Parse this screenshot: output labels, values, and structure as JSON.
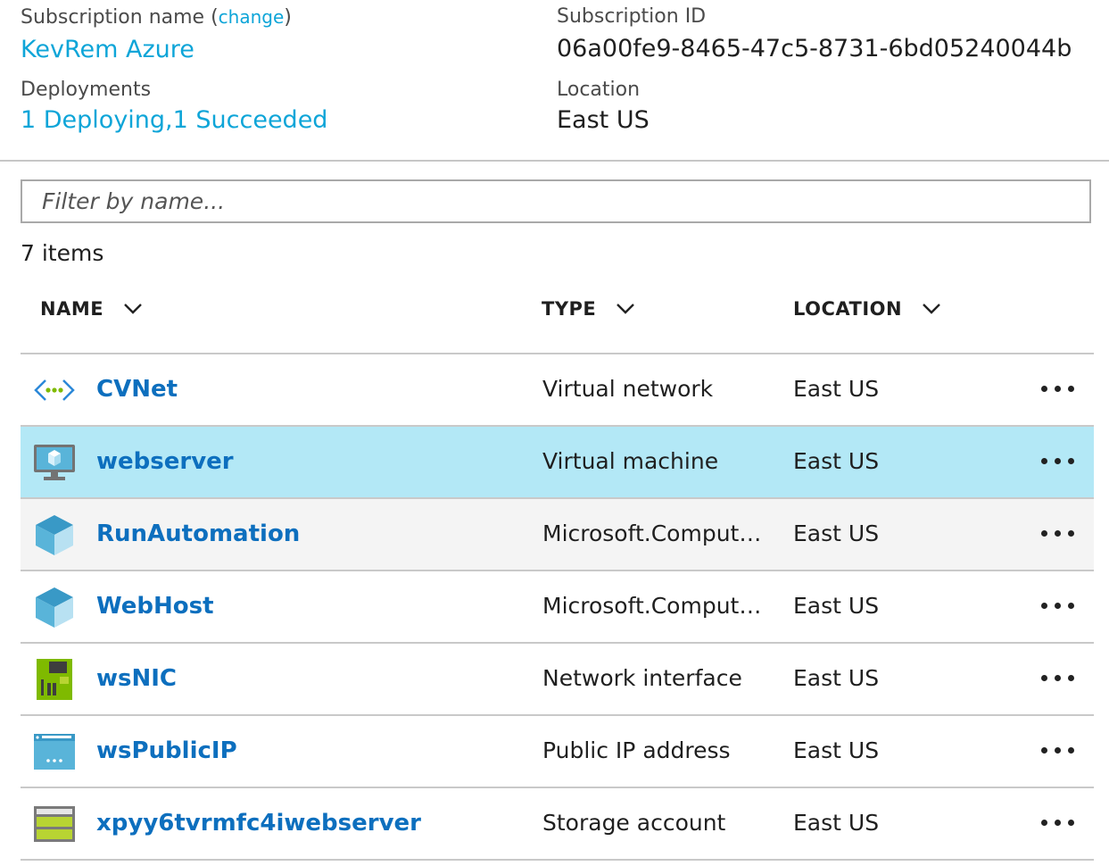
{
  "essentials": {
    "subscription_name_label": "Subscription name",
    "change_open": "(",
    "change_link": "change",
    "change_close": ")",
    "subscription_name": "KevRem Azure",
    "subscription_id_label": "Subscription ID",
    "subscription_id": "06a00fe9-8465-47c5-8731-6bd05240044b",
    "deployments_label": "Deployments",
    "deployments": "1 Deploying,1 Succeeded",
    "location_label": "Location",
    "location": "East US"
  },
  "filter": {
    "placeholder": "Filter by name..."
  },
  "item_count": "7 items",
  "columns": {
    "name": "NAME",
    "type": "TYPE",
    "location": "LOCATION"
  },
  "colors": {
    "link": "#0ea5d8",
    "name_link": "#0d6fbe",
    "selected_row": "#b3e8f6"
  },
  "resources": [
    {
      "name": "CVNet",
      "type": "Virtual network",
      "location": "East US",
      "icon": "virtual-network-icon"
    },
    {
      "name": "webserver",
      "type": "Virtual machine",
      "location": "East US",
      "icon": "virtual-machine-icon",
      "selected": true
    },
    {
      "name": "RunAutomation",
      "type": "Microsoft.Compute...",
      "location": "East US",
      "icon": "compute-cube-icon"
    },
    {
      "name": "WebHost",
      "type": "Microsoft.Compute...",
      "location": "East US",
      "icon": "compute-cube-icon"
    },
    {
      "name": "wsNIC",
      "type": "Network interface",
      "location": "East US",
      "icon": "network-interface-icon"
    },
    {
      "name": "wsPublicIP",
      "type": "Public IP address",
      "location": "East US",
      "icon": "public-ip-icon"
    },
    {
      "name": "xpyy6tvrmfc4iwebserver",
      "type": "Storage account",
      "location": "East US",
      "icon": "storage-account-icon"
    }
  ]
}
